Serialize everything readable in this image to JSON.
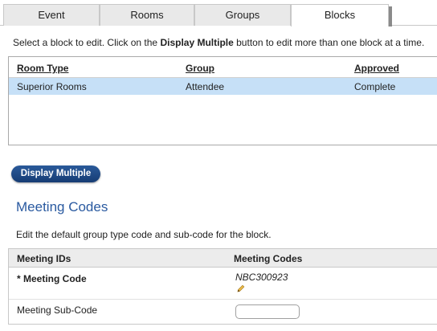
{
  "tabs": [
    {
      "label": "Event"
    },
    {
      "label": "Rooms"
    },
    {
      "label": "Groups"
    },
    {
      "label": "Blocks",
      "active": true
    }
  ],
  "instructions": {
    "before": "Select a block to edit. Click on the ",
    "emphasis": "Display Multiple",
    "after": " button to edit more than one block at a time."
  },
  "blocks_table": {
    "headers": [
      "Room Type",
      "Group",
      "Approved"
    ],
    "rows": [
      {
        "room_type": "Superior Rooms",
        "group": "Attendee",
        "approved": "Complete",
        "selected": true
      }
    ]
  },
  "display_multiple_button": "Display Multiple",
  "meeting_codes": {
    "title": "Meeting Codes",
    "description": "Edit the default group type code and sub-code for the block.",
    "headers": [
      "Meeting IDs",
      "Meeting Codes"
    ],
    "meeting_code_label": "* Meeting Code",
    "meeting_code_value": "NBC300923",
    "sub_code_label": "Meeting Sub-Code",
    "sub_code_value": ""
  },
  "colors": {
    "selected_row": "#c6e0f7",
    "button": "#1f4a87",
    "title": "#2a5aa0"
  },
  "icons": {
    "edit": "pencil-icon"
  }
}
